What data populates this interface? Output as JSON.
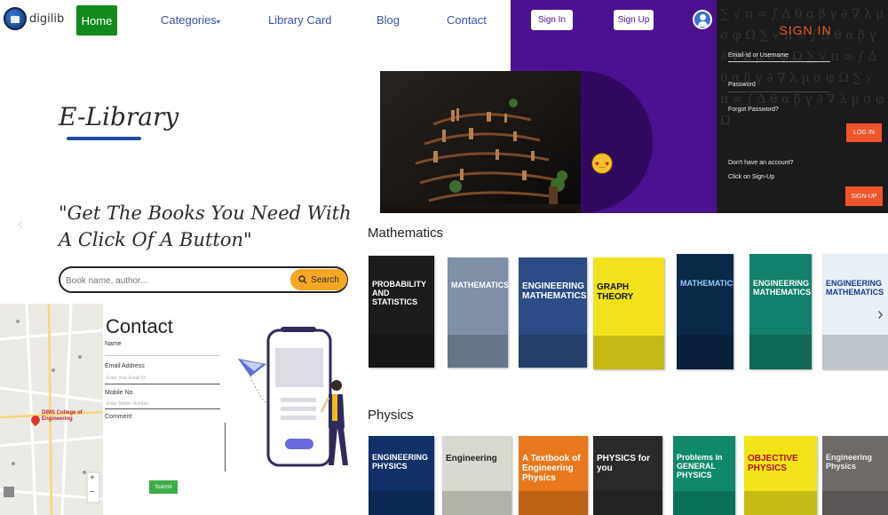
{
  "nav": {
    "brand": "digilib",
    "links": [
      "Home",
      "Categories",
      "Library Card",
      "Blog",
      "Contact"
    ],
    "categories_caret": "▾"
  },
  "header": {
    "sign_in_label": "Sign In",
    "sign_up_label": "Sign Up"
  },
  "signin_panel": {
    "title": "SIGN IN",
    "email_label": "Email-Id or Username",
    "password_label": "Password",
    "forgot_label": "Forgot Password?",
    "login_label": "LOG IN",
    "no_account_label": "Don't have an account?",
    "click_signup_label": "Click on Sign-Up",
    "signup_label": "SIGN-UP"
  },
  "hero": {
    "title": "E-Library",
    "quote": "\"Get The Books You Need With A Click Of A Button\"",
    "prev_arrow": "‹",
    "search_placeholder": "Book name, author...",
    "search_label": "Search"
  },
  "contact": {
    "title": "Contact",
    "name_label": "Name",
    "email_label": "Email Address",
    "email_placeholder": "Enter Your Email ID",
    "mobile_label": "Mobile No.",
    "mobile_placeholder": "Enter Mobile Number",
    "comment_label": "Comment",
    "submit_label": "Submit"
  },
  "map": {
    "pin_label": "DIMS College of Engineering",
    "zoom_in": "+",
    "zoom_out": "−"
  },
  "sections": [
    {
      "title": "Mathematics",
      "books": [
        {
          "title": "PROBABILITY AND STATISTICS",
          "bg": "#1c1c1c",
          "fg": "#ffffff"
        },
        {
          "title": "MATHEMATICS",
          "bg": "#7e8fa6",
          "fg": "#ffffff"
        },
        {
          "title": "ENGINEERING MATHEMATICS",
          "bg": "#2d4b86",
          "fg": "#ffffff"
        },
        {
          "title": "GRAPH THEORY",
          "bg": "#f1e21c",
          "fg": "#111111"
        },
        {
          "title": "MATHEMATICS",
          "bg": "#0b2848",
          "fg": "#8fd1ff"
        },
        {
          "title": "ENGINEERING MATHEMATICS",
          "bg": "#12806a",
          "fg": "#ffffff"
        },
        {
          "title": "ENGINEERING MATHEMATICS",
          "bg": "#e8f0f8",
          "fg": "#1b3a8a"
        }
      ]
    },
    {
      "title": "Physics",
      "books": [
        {
          "title": "ENGINEERING PHYSICS",
          "bg": "#10306a",
          "fg": "#ffffff"
        },
        {
          "title": "Engineering",
          "bg": "#d8d8d0",
          "fg": "#222222"
        },
        {
          "title": "A Textbook of Engineering Physics",
          "bg": "#e8781c",
          "fg": "#ffffff"
        },
        {
          "title": "PHYSICS for you",
          "bg": "#2a2a2a",
          "fg": "#ffffff"
        },
        {
          "title": "Problems in GENERAL PHYSICS",
          "bg": "#0e8a6a",
          "fg": "#ffffff"
        },
        {
          "title": "OBJECTIVE PHYSICS",
          "bg": "#f2e418",
          "fg": "#b0121a"
        },
        {
          "title": "Engineering Physics",
          "bg": "#6e6a68",
          "fg": "#eeeeee"
        }
      ]
    }
  ],
  "rail_next": "›",
  "colors": {
    "nav_home": "#118a1b",
    "nav_link": "#3a4fb0",
    "purple": "#4a1190",
    "accent_orange": "#f0542a",
    "search_yellow": "#f5a623"
  }
}
